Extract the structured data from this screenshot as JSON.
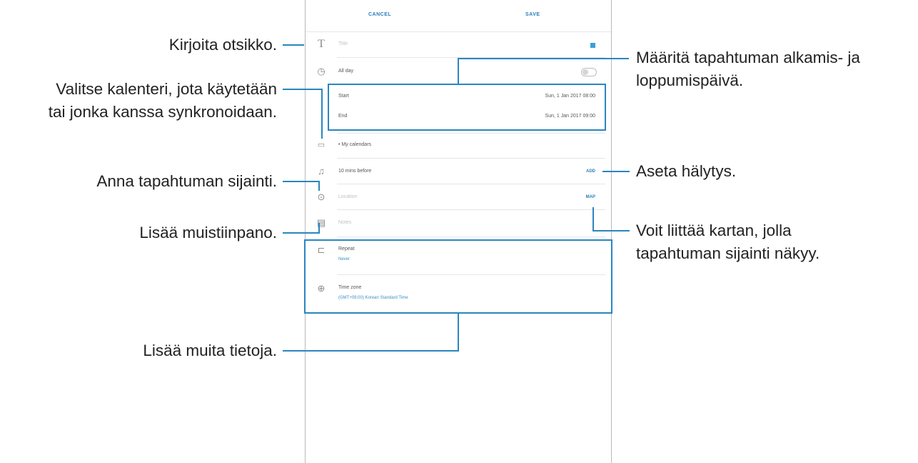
{
  "app": {
    "cancel": "CANCEL",
    "save": "SAVE",
    "title_placeholder": "Title",
    "all_day": "All day",
    "start_label": "Start",
    "start_value": "Sun, 1 Jan 2017   08:00",
    "end_label": "End",
    "end_value": "Sun, 1 Jan 2017   09:00",
    "calendar": "• My calendars",
    "reminder": "10 mins before",
    "reminder_action": "ADD",
    "location_placeholder": "Location",
    "location_action": "MAP",
    "notes_placeholder": "Notes",
    "repeat_label": "Repeat",
    "repeat_value": "Never",
    "timezone_label": "Time zone",
    "timezone_value": "(GMT+09:00) Korean Standard Time",
    "accent_color": "#2a86bf"
  },
  "annotations": {
    "title": "Kirjoita otsikko.",
    "calendar_line1": "Valitse kalenteri, jota käytetään",
    "calendar_line2": "tai jonka kanssa synkronoidaan.",
    "location": "Anna tapahtuman sijainti.",
    "notes": "Lisää muistiinpano.",
    "dates_line1": "Määritä tapahtuman alkamis- ja",
    "dates_line2": "loppumispäivä.",
    "alarm": "Aseta hälytys.",
    "map_line1": "Voit liittää kartan, jolla",
    "map_line2": "tapahtuman sijainti näkyy.",
    "more": "Lisää muita tietoja."
  }
}
